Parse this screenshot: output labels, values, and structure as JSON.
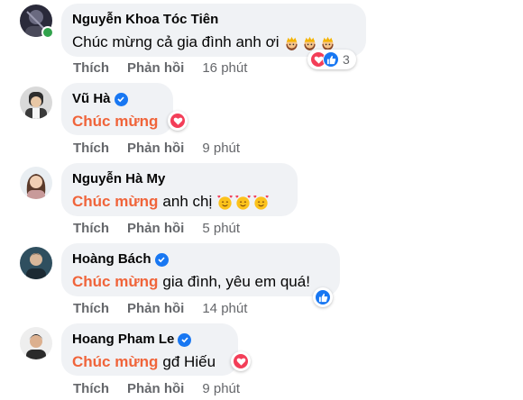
{
  "comments": [
    {
      "name": "Nguyễn Khoa Tóc Tiên",
      "verified": false,
      "highlight": "",
      "text": "Chúc mừng cả gia đình anh ơi",
      "emojis": [
        "woman-crown-emoji",
        "woman-crown-emoji",
        "woman-crown-emoji"
      ],
      "reactions": [
        "love",
        "like"
      ],
      "reaction_count": "3",
      "like": "Thích",
      "reply": "Phản hồi",
      "time": "16 phút",
      "online": true
    },
    {
      "name": "Vũ Hà",
      "verified": true,
      "highlight": "Chúc mừng",
      "text": "",
      "emojis": [],
      "reactions": [
        "love"
      ],
      "reaction_count": "",
      "like": "Thích",
      "reply": "Phản hồi",
      "time": "9 phút",
      "online": false
    },
    {
      "name": "Nguyễn Hà My",
      "verified": false,
      "highlight": "Chúc mừng",
      "text": "anh chị",
      "emojis": [
        "smiling-face-hearts-emoji",
        "smiling-face-hearts-emoji",
        "smiling-face-hearts-emoji"
      ],
      "reactions": [],
      "reaction_count": "",
      "like": "Thích",
      "reply": "Phản hồi",
      "time": "5 phút",
      "online": false
    },
    {
      "name": "Hoàng Bách",
      "verified": true,
      "highlight": "Chúc mừng",
      "text": "gia đình, yêu em quá!",
      "emojis": [],
      "reactions": [
        "like"
      ],
      "reaction_count": "",
      "like": "Thích",
      "reply": "Phản hồi",
      "time": "14 phút",
      "online": false
    },
    {
      "name": "Hoang Pham Le",
      "verified": true,
      "highlight": "Chúc mừng",
      "text": "gđ Hiếu",
      "emojis": [],
      "reactions": [
        "love"
      ],
      "reaction_count": "",
      "like": "Thích",
      "reply": "Phản hồi",
      "time": "9 phút",
      "online": false
    }
  ],
  "colors": {
    "bubble": "#f0f2f5",
    "highlight": "#f0643a",
    "love": "#f33e58",
    "like": "#1877f2",
    "online": "#31a24c"
  }
}
